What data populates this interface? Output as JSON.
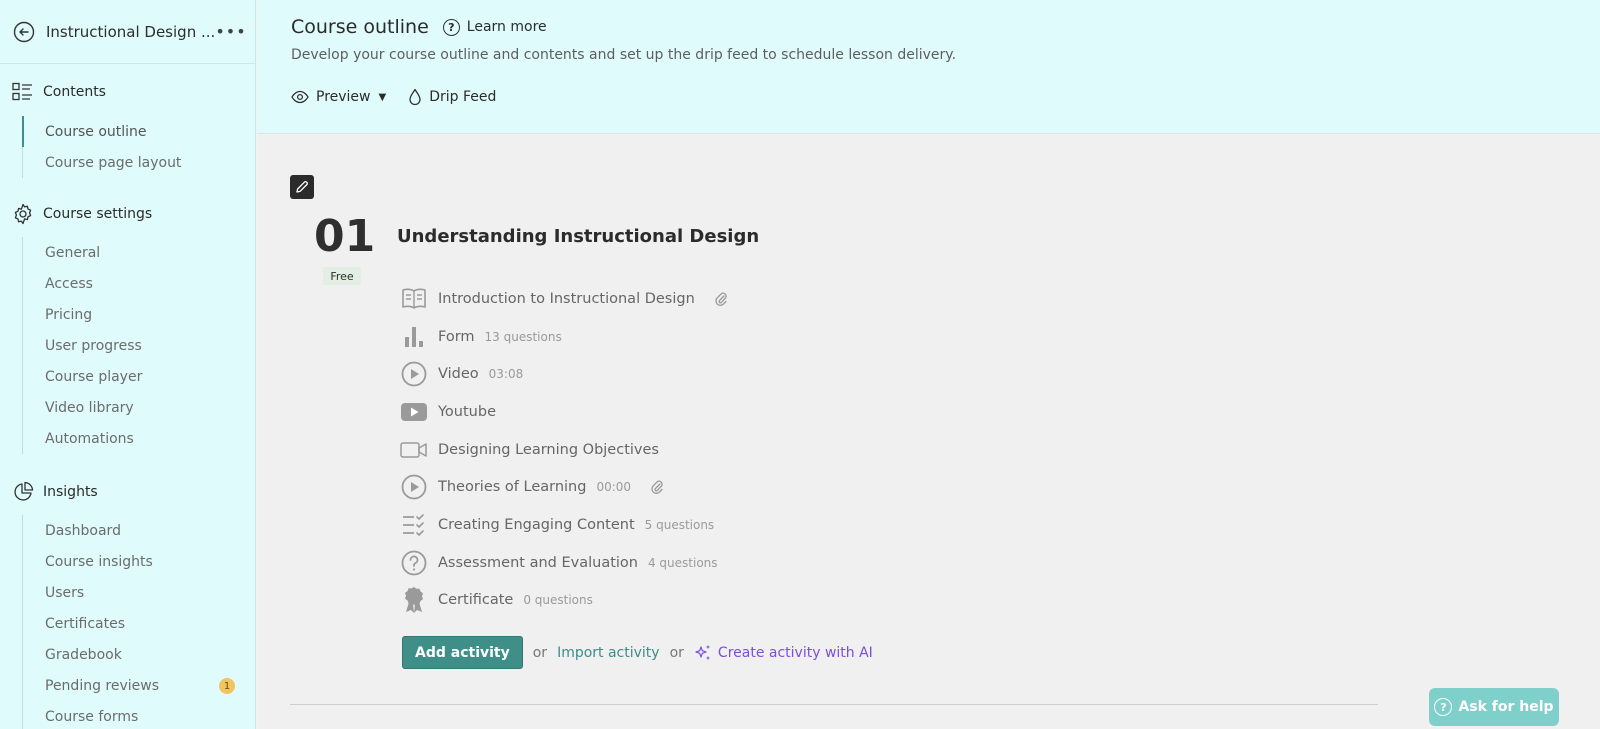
{
  "sidebar": {
    "course_title": "Instructional Design ...",
    "sections": [
      {
        "label": "Contents",
        "icon": "list-icon",
        "items": [
          {
            "label": "Course outline",
            "active": true
          },
          {
            "label": "Course page layout",
            "active": false
          }
        ]
      },
      {
        "label": "Course settings",
        "icon": "gear-icon",
        "items": [
          {
            "label": "General"
          },
          {
            "label": "Access"
          },
          {
            "label": "Pricing"
          },
          {
            "label": "User progress"
          },
          {
            "label": "Course player"
          },
          {
            "label": "Video library"
          },
          {
            "label": "Automations"
          }
        ]
      },
      {
        "label": "Insights",
        "icon": "pie-chart-icon",
        "items": [
          {
            "label": "Dashboard"
          },
          {
            "label": "Course insights"
          },
          {
            "label": "Users"
          },
          {
            "label": "Certificates"
          },
          {
            "label": "Gradebook"
          },
          {
            "label": "Pending reviews",
            "badge": "1"
          },
          {
            "label": "Course forms"
          }
        ]
      }
    ]
  },
  "header": {
    "title": "Course outline",
    "learn_more": "Learn more",
    "description": "Develop your course outline and contents and set up the drip feed to schedule lesson delivery.",
    "preview_label": "Preview",
    "drip_feed_label": "Drip Feed"
  },
  "lesson": {
    "number": "01",
    "free_label": "Free",
    "title": "Understanding Instructional Design",
    "activities": [
      {
        "label": "Introduction to Instructional Design",
        "meta": "",
        "icon": "book-icon",
        "attachment": true
      },
      {
        "label": "Form",
        "meta": "13 questions",
        "icon": "bar-chart-icon",
        "attachment": false
      },
      {
        "label": "Video",
        "meta": "03:08",
        "icon": "play-circle-icon",
        "attachment": false
      },
      {
        "label": "Youtube",
        "meta": "",
        "icon": "youtube-icon",
        "attachment": false
      },
      {
        "label": "Designing Learning Objectives",
        "meta": "",
        "icon": "video-camera-icon",
        "attachment": false
      },
      {
        "label": "Theories of Learning",
        "meta": "00:00",
        "icon": "play-circle-icon",
        "attachment": true
      },
      {
        "label": "Creating Engaging Content",
        "meta": "5 questions",
        "icon": "checklist-icon",
        "attachment": false
      },
      {
        "label": "Assessment and Evaluation",
        "meta": "4 questions",
        "icon": "question-circle-icon",
        "attachment": false
      },
      {
        "label": "Certificate",
        "meta": "0 questions",
        "icon": "award-icon",
        "attachment": false
      }
    ],
    "add_activity": "Add activity",
    "or1": "or",
    "import_activity": "Import activity",
    "or2": "or",
    "create_ai": "Create activity with AI"
  },
  "help": {
    "label": "Ask for help"
  },
  "colors": {
    "sidebar_bg": "#e0fbfc",
    "accent": "#3f8f88",
    "ai_purple": "#7b4fd8",
    "help_button": "#7fcfcb"
  }
}
